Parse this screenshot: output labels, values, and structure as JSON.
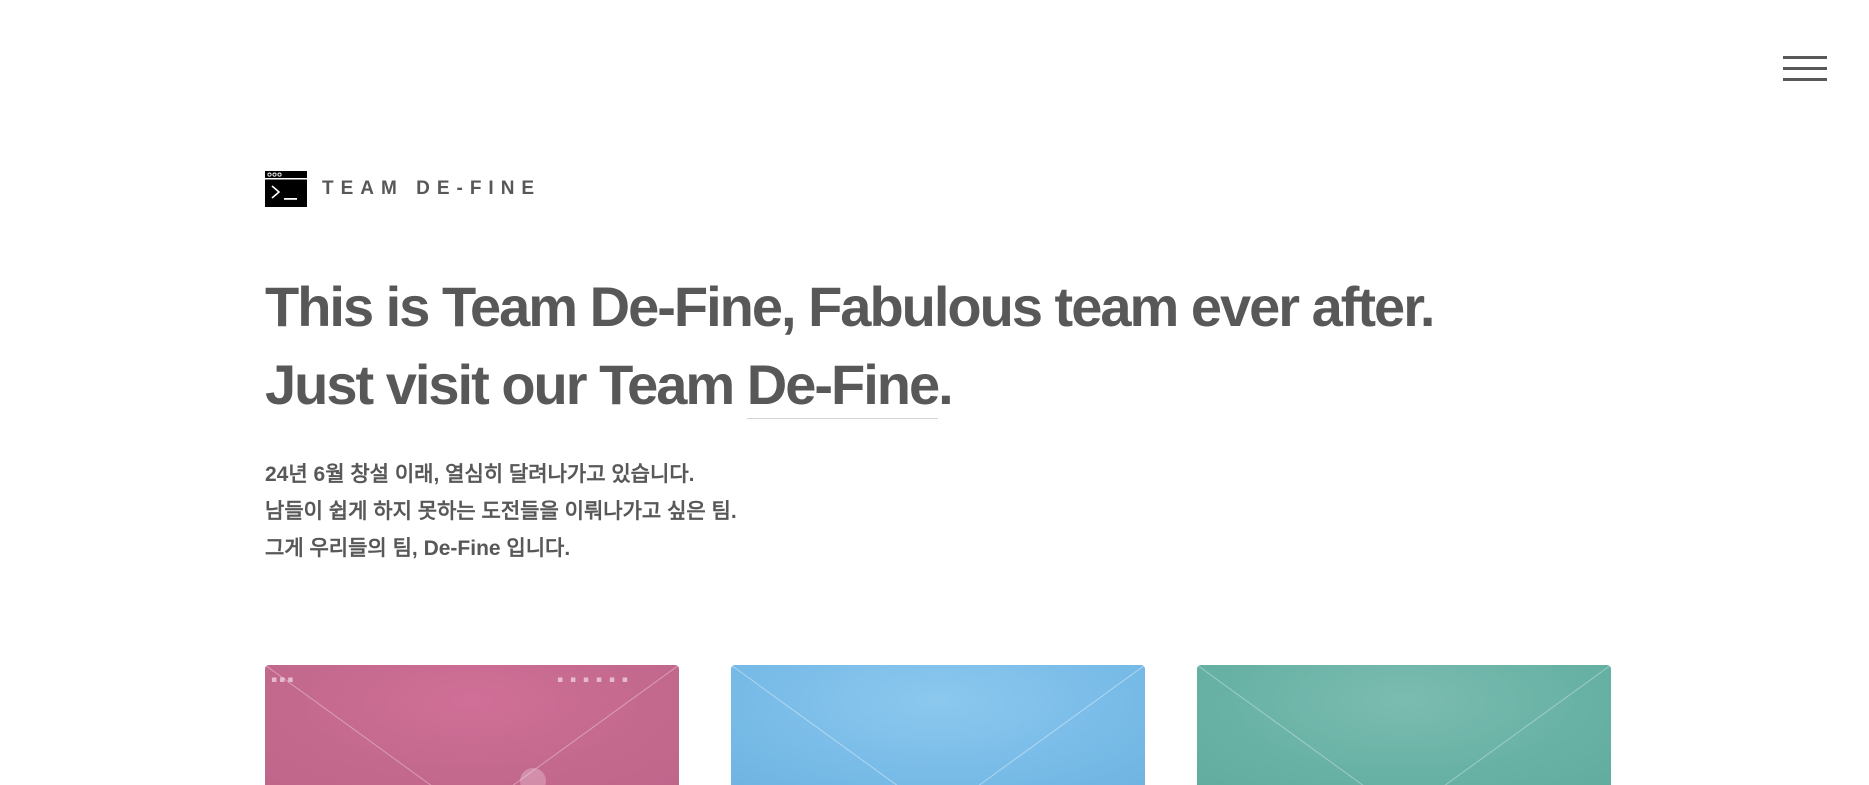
{
  "header": {
    "menu_icon": "hamburger-menu-icon"
  },
  "brand": {
    "logo_icon": "terminal-window-icon",
    "name": "TEAM DE-FINE"
  },
  "hero": {
    "line1": "This is Team De-Fine, Fabulous team ever after.",
    "line2_prefix": "Just visit our Team ",
    "line2_link": "De-Fine",
    "line2_suffix": "."
  },
  "intro": {
    "lines": [
      "24년 6월 창설 이래, 열심히 달려나가고 있습니다.",
      "남들이 쉽게 하지 못하는 도전들을 이뤄나가고 싶은 팀.",
      "그게 우리들의 팀, De-Fine 입니다."
    ]
  },
  "cards": [
    {
      "color": "#c4698e"
    },
    {
      "color": "#79bce8"
    },
    {
      "color": "#68b2a5"
    }
  ]
}
